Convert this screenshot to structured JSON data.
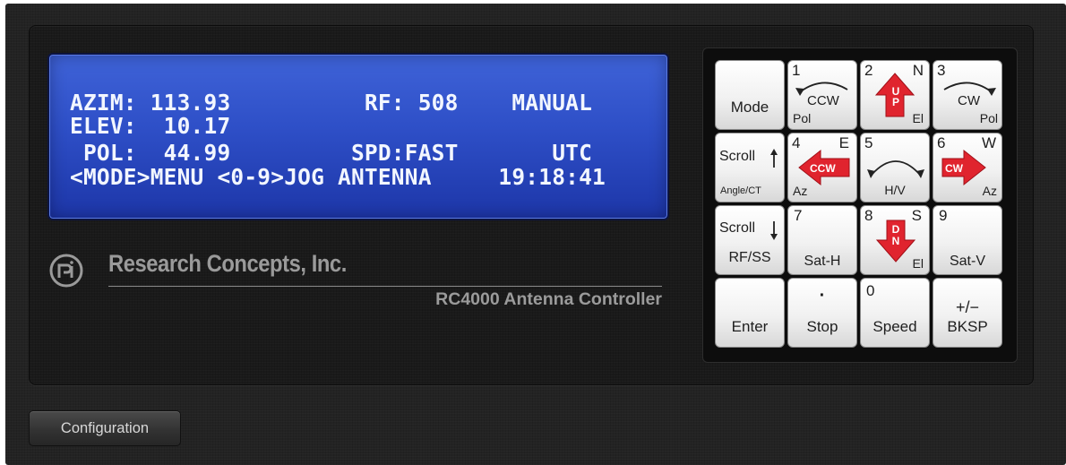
{
  "lcd": {
    "line1": "AZIM: 113.93          RF: 508    MANUAL",
    "line2": "ELEV:  10.17",
    "line3": " POL:  44.99         SPD:FAST       UTC",
    "line4": "<MODE>MENU <0-9>JOG ANTENNA     19:18:41",
    "bg_color": "#2e4fc7",
    "text_color": "#f2f6ff"
  },
  "branding": {
    "company": "Research Concepts, Inc.",
    "model": "RC4000 Antenna Controller",
    "logo_icon": "rci-logo-icon"
  },
  "keypad": {
    "accent_color": "#e0242e",
    "mode": {
      "label": "Mode"
    },
    "k1": {
      "digit": "1",
      "label": "CCW",
      "sub": "Pol",
      "icon": "curved-arrow-left-icon"
    },
    "k2": {
      "digit": "2",
      "dir": "N",
      "arrow_text": "UP",
      "sub": "El",
      "icon": "arrow-up-icon"
    },
    "k3": {
      "digit": "3",
      "label": "CW",
      "sub": "Pol",
      "icon": "curved-arrow-right-icon"
    },
    "scroll_up": {
      "label": "Scroll",
      "sub": "Angle/CT",
      "icon": "arrow-up-icon"
    },
    "k4": {
      "digit": "4",
      "dir": "E",
      "arrow_text": "CCW",
      "sub": "Az",
      "icon": "arrow-left-icon"
    },
    "k5": {
      "digit": "5",
      "sub": "H/V",
      "icon": "curved-arrow-icon"
    },
    "k6": {
      "digit": "6",
      "dir": "W",
      "arrow_text": "CW",
      "sub": "Az",
      "icon": "arrow-right-icon"
    },
    "scroll_down": {
      "label": "Scroll",
      "sub": "RF/SS",
      "icon": "arrow-down-icon"
    },
    "k7": {
      "digit": "7",
      "sub": "Sat-H"
    },
    "k8": {
      "digit": "8",
      "dir": "S",
      "arrow_text": "DN",
      "sub": "El",
      "icon": "arrow-down-icon"
    },
    "k9": {
      "digit": "9",
      "sub": "Sat-V"
    },
    "enter": {
      "label": "Enter"
    },
    "stop": {
      "digit": "·",
      "label": "Stop"
    },
    "speed": {
      "digit": "0",
      "label": "Speed"
    },
    "bksp": {
      "digit": "+/−",
      "label": "BKSP"
    }
  },
  "footer": {
    "config_button": "Configuration"
  }
}
